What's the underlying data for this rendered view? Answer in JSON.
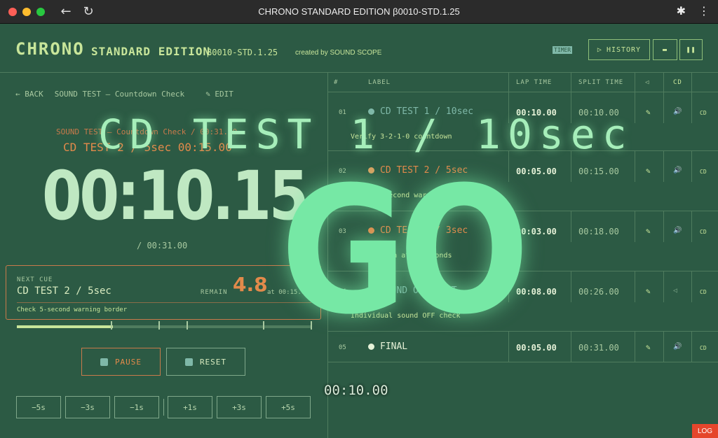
{
  "browser": {
    "title": "CHRONO STANDARD EDITION β0010-STD.1.25",
    "back_icon": "←",
    "reload_icon": "↻",
    "extensions_icon": "✱",
    "menu_icon": "⋮"
  },
  "header": {
    "brand": "CHRONO",
    "edition": "STANDARD EDITION",
    "version": "β0010-STD.1.25",
    "credit": "created by SOUND SCOPE",
    "timer_badge": "TIMER",
    "history_label": "HISTORY",
    "history_icon": "▷",
    "keyboard_icon": "▬",
    "pause_icon": "❚❚"
  },
  "left": {
    "back_label": "← BACK",
    "breadcrumb": "SOUND TEST — Countdown Check",
    "edit_label": "✎ EDIT",
    "crumb_total": "SOUND TEST — Countdown Check / 00:31.00",
    "current_cue": "CD TEST 2 / 5sec 00:15.00",
    "elapsed": "00:10.15",
    "total": "/ 00:31.00",
    "next_cue": {
      "label": "NEXT CUE",
      "name": "CD TEST 2 / 5sec",
      "remain_label": "REMAIN",
      "remain": "4.8",
      "at": "at 00:15.00",
      "note": "Check 5-second warning border"
    },
    "progress": 0.327,
    "pause_label": "PAUSE",
    "reset_label": "RESET",
    "steps": [
      "−5s",
      "−3s",
      "−1s",
      "+1s",
      "+3s",
      "+5s"
    ]
  },
  "table": {
    "headers": {
      "num": "#",
      "label": "LABEL",
      "lap": "LAP TIME",
      "split": "SPLIT TIME",
      "sound": "◁",
      "cd": "CD"
    },
    "rows": [
      {
        "num": "01",
        "label": "CD TEST 1 / 10sec",
        "lap": "00:10.00",
        "split": "00:10.00",
        "note": "Verify 3-2-1-0 countdown",
        "bullet": "#7fb8a8",
        "color": "#7fb8a8",
        "cd": "CD",
        "edit": "✎",
        "sound": "🔊"
      },
      {
        "num": "02",
        "label": "CD TEST 2 / 5sec",
        "lap": "00:05.00",
        "split": "00:15.00",
        "note": "Check 5-second warning border",
        "bullet": "#d9a060",
        "color": "#e28a4b",
        "cd": "CD",
        "edit": "✎",
        "sound": "🔊"
      },
      {
        "num": "03",
        "label": "CD TEST 3 / 3sec",
        "lap": "00:03.00",
        "split": "00:18.00",
        "note": "Check flash at 3 seconds",
        "bullet": "#e28a4b",
        "color": "#e28a4b",
        "cd": "CD",
        "edit": "✎",
        "sound": "🔊"
      },
      {
        "num": "04",
        "label": "SOUND OFF TEST",
        "lap": "00:08.00",
        "split": "00:26.00",
        "note": "Individual sound OFF check",
        "bullet": "#7fb8a8",
        "color": "#7fb8a8",
        "cd": "CD",
        "edit": "✎",
        "sound": "◁"
      },
      {
        "num": "05",
        "label": "FINAL",
        "lap": "00:05.00",
        "split": "00:31.00",
        "note": "",
        "bullet": "#e6f2d8",
        "color": "#e6f2d8",
        "cd": "CD",
        "edit": "✎",
        "sound": "🔊"
      }
    ]
  },
  "overlay": {
    "title": "CD TEST 1 / 10sec",
    "go": "GO",
    "time": "00:10.00"
  },
  "log_label": "LOG",
  "colors": {
    "background": "#2c5a44",
    "accent": "#c8e59a",
    "warn": "#e28a4b",
    "go": "#76e8a5"
  }
}
